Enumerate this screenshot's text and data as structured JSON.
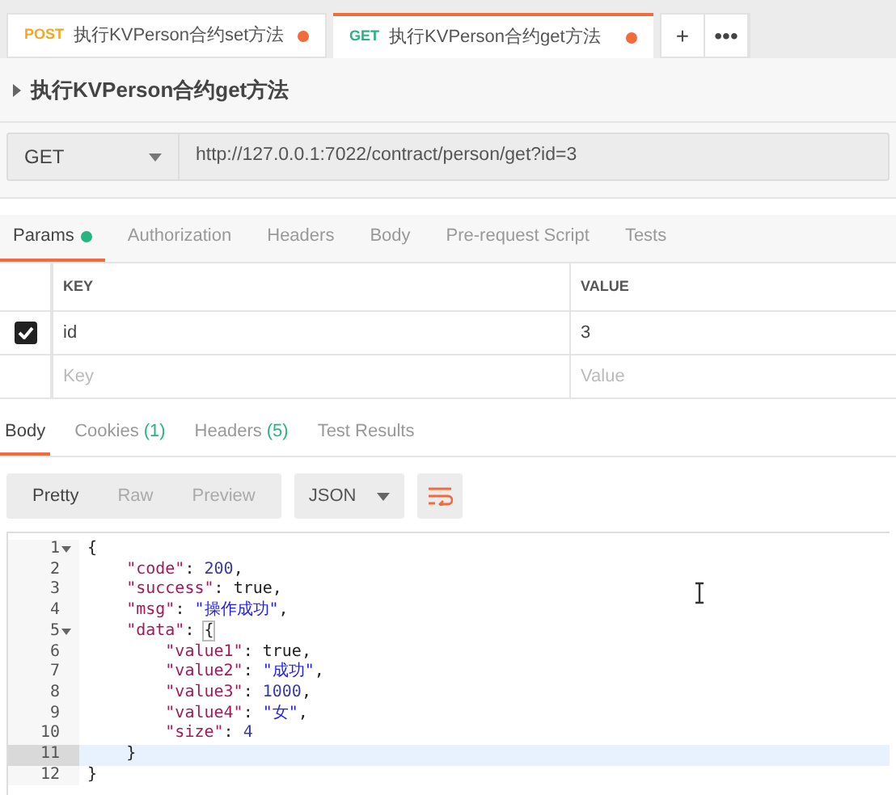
{
  "request_tabs": [
    {
      "method": "POST",
      "color": "#f5a623",
      "title": "执行KVPerson合约set方法",
      "unsaved": true,
      "selected": false
    },
    {
      "method": "GET",
      "color": "#26b47f",
      "title": "执行KVPerson合约get方法",
      "unsaved": true,
      "selected": true
    }
  ],
  "tab_actions": [
    "+",
    "•••"
  ],
  "request_name": "执行KVPerson合约get方法",
  "method": "GET",
  "url": "http://127.0.0.1:7022/contract/person/get?id=3",
  "request_sections": [
    {
      "label": "Params",
      "dot": true,
      "selected": true
    },
    {
      "label": "Authorization",
      "dot": false,
      "selected": false
    },
    {
      "label": "Headers",
      "dot": false,
      "selected": false
    },
    {
      "label": "Body",
      "dot": false,
      "selected": false
    },
    {
      "label": "Pre-request Script",
      "dot": false,
      "selected": false
    },
    {
      "label": "Tests",
      "dot": false,
      "selected": false
    }
  ],
  "params": {
    "columns": [
      "KEY",
      "VALUE"
    ],
    "rows": [
      {
        "checked": true,
        "key": "id",
        "value": "3"
      }
    ],
    "new_row": {
      "key_placeholder": "Key",
      "value_placeholder": "Value"
    }
  },
  "response_sections": [
    {
      "label": "Body",
      "selected": true
    },
    {
      "label": "Cookies",
      "count": "(1)",
      "selected": false
    },
    {
      "label": "Headers",
      "count": "(5)",
      "selected": false
    },
    {
      "label": "Test Results",
      "selected": false
    }
  ],
  "view_modes": [
    {
      "label": "Pretty",
      "selected": true
    },
    {
      "label": "Raw",
      "selected": false
    },
    {
      "label": "Preview",
      "selected": false
    }
  ],
  "format": "JSON",
  "code_lines": [
    {
      "number": "1",
      "foldable": true,
      "active": false,
      "tokens": [
        {
          "kind": "punct",
          "text": "{"
        }
      ]
    },
    {
      "number": "2",
      "foldable": false,
      "active": false,
      "tokens": [
        {
          "kind": "key",
          "text": "    \"code\""
        },
        {
          "kind": "punct",
          "text": ": "
        },
        {
          "kind": "number",
          "text": "200"
        },
        {
          "kind": "punct",
          "text": ","
        }
      ]
    },
    {
      "number": "3",
      "foldable": false,
      "active": false,
      "tokens": [
        {
          "kind": "key",
          "text": "    \"success\""
        },
        {
          "kind": "punct",
          "text": ": "
        },
        {
          "kind": "bool",
          "text": "true"
        },
        {
          "kind": "punct",
          "text": ","
        }
      ]
    },
    {
      "number": "4",
      "foldable": false,
      "active": false,
      "tokens": [
        {
          "kind": "key",
          "text": "    \"msg\""
        },
        {
          "kind": "punct",
          "text": ": "
        },
        {
          "kind": "string",
          "text": "\"操作成功\""
        },
        {
          "kind": "punct",
          "text": ","
        }
      ]
    },
    {
      "number": "5",
      "foldable": true,
      "active": false,
      "tokens": [
        {
          "kind": "key",
          "text": "    \"data\""
        },
        {
          "kind": "punct",
          "text": ": "
        },
        {
          "kind": "bracket",
          "text": "{"
        }
      ]
    },
    {
      "number": "6",
      "foldable": false,
      "active": false,
      "tokens": [
        {
          "kind": "key",
          "text": "        \"value1\""
        },
        {
          "kind": "punct",
          "text": ": "
        },
        {
          "kind": "bool",
          "text": "true"
        },
        {
          "kind": "punct",
          "text": ","
        }
      ]
    },
    {
      "number": "7",
      "foldable": false,
      "active": false,
      "tokens": [
        {
          "kind": "key",
          "text": "        \"value2\""
        },
        {
          "kind": "punct",
          "text": ": "
        },
        {
          "kind": "string",
          "text": "\"成功\""
        },
        {
          "kind": "punct",
          "text": ","
        }
      ]
    },
    {
      "number": "8",
      "foldable": false,
      "active": false,
      "tokens": [
        {
          "kind": "key",
          "text": "        \"value3\""
        },
        {
          "kind": "punct",
          "text": ": "
        },
        {
          "kind": "number",
          "text": "1000"
        },
        {
          "kind": "punct",
          "text": ","
        }
      ]
    },
    {
      "number": "9",
      "foldable": false,
      "active": false,
      "tokens": [
        {
          "kind": "key",
          "text": "        \"value4\""
        },
        {
          "kind": "punct",
          "text": ": "
        },
        {
          "kind": "string",
          "text": "\"女\""
        },
        {
          "kind": "punct",
          "text": ","
        }
      ]
    },
    {
      "number": "10",
      "foldable": false,
      "active": false,
      "tokens": [
        {
          "kind": "key",
          "text": "        \"size\""
        },
        {
          "kind": "punct",
          "text": ": "
        },
        {
          "kind": "number",
          "text": "4"
        }
      ]
    },
    {
      "number": "11",
      "foldable": false,
      "active": true,
      "tokens": [
        {
          "kind": "punct",
          "text": "    }"
        }
      ]
    },
    {
      "number": "12",
      "foldable": false,
      "active": false,
      "tokens": [
        {
          "kind": "punct",
          "text": "}"
        }
      ]
    }
  ]
}
